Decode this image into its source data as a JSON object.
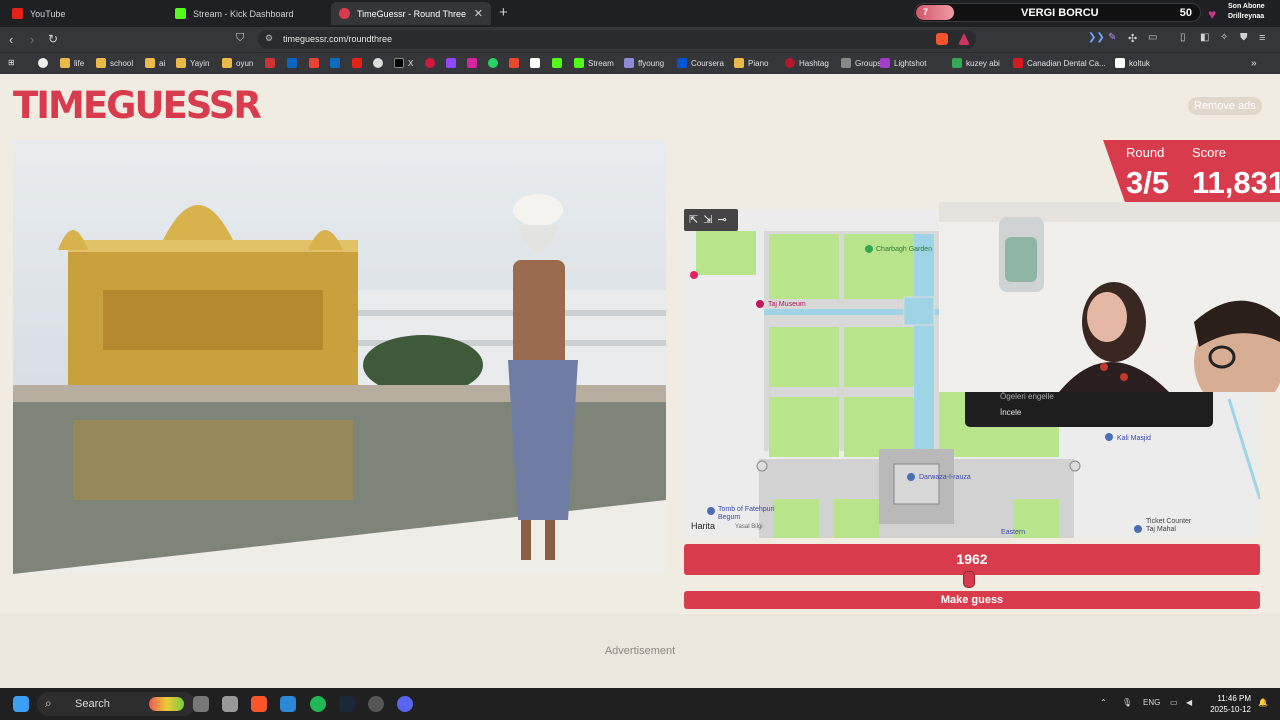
{
  "tabs": [
    {
      "label": "YouTube",
      "color": "#e62117"
    },
    {
      "label": "Stream - Kick Dashboard",
      "color": "#53fc18"
    },
    {
      "label": "TimeGuessr - Round Three",
      "color": "#d83c4c"
    }
  ],
  "overlay": {
    "counter": "7",
    "title": "VERGI BORCU",
    "value": "50",
    "sub_line1": "Son Abone",
    "sub_line2": "Drillreynaa"
  },
  "address": {
    "url": "timeguessr.com/roundthree"
  },
  "bookmarks": [
    {
      "label": "life"
    },
    {
      "label": "school"
    },
    {
      "label": "ai"
    },
    {
      "label": "Yayin"
    },
    {
      "label": "oyun"
    },
    {
      "label": "X"
    },
    {
      "label": "Stream"
    },
    {
      "label": "ffyoung"
    },
    {
      "label": "Coursera"
    },
    {
      "label": "Piano"
    },
    {
      "label": "Hashtag"
    },
    {
      "label": "Groups"
    },
    {
      "label": "Lightshot"
    },
    {
      "label": "kuzey abi"
    },
    {
      "label": "Canadian Dental Ca..."
    },
    {
      "label": "koltuk"
    }
  ],
  "game": {
    "logo": "TIMEGUESSR",
    "remove_ads": "Remove ads",
    "round_label": "Round",
    "round_value": "3/5",
    "score_label": "Score",
    "score_value": "11,831",
    "year": "1962",
    "year_slider_fraction": 0.495,
    "guess_label": "Make guess",
    "ad_label": "Advertisement"
  },
  "map": {
    "labels": {
      "charbagh": "Charbagh Garden",
      "museum": "Taj Museum",
      "darwaza": "Darwaza-I-rauza",
      "kali": "Kali Masjid",
      "tomb": "Tomb of Fatehpuri Begum",
      "ticket_line1": "Ticket Counter",
      "ticket_line2": "Taj Mahal",
      "eastern": "Eastern",
      "attribution": "Harita",
      "legal": "Yasal Bilgi"
    }
  },
  "context_menu": {
    "item1": "Ögeleri engelle",
    "item2": "İncele"
  },
  "taskbar": {
    "search": "Search",
    "lang": "ENG",
    "time": "11:46 PM",
    "date": "2025-10-12"
  }
}
